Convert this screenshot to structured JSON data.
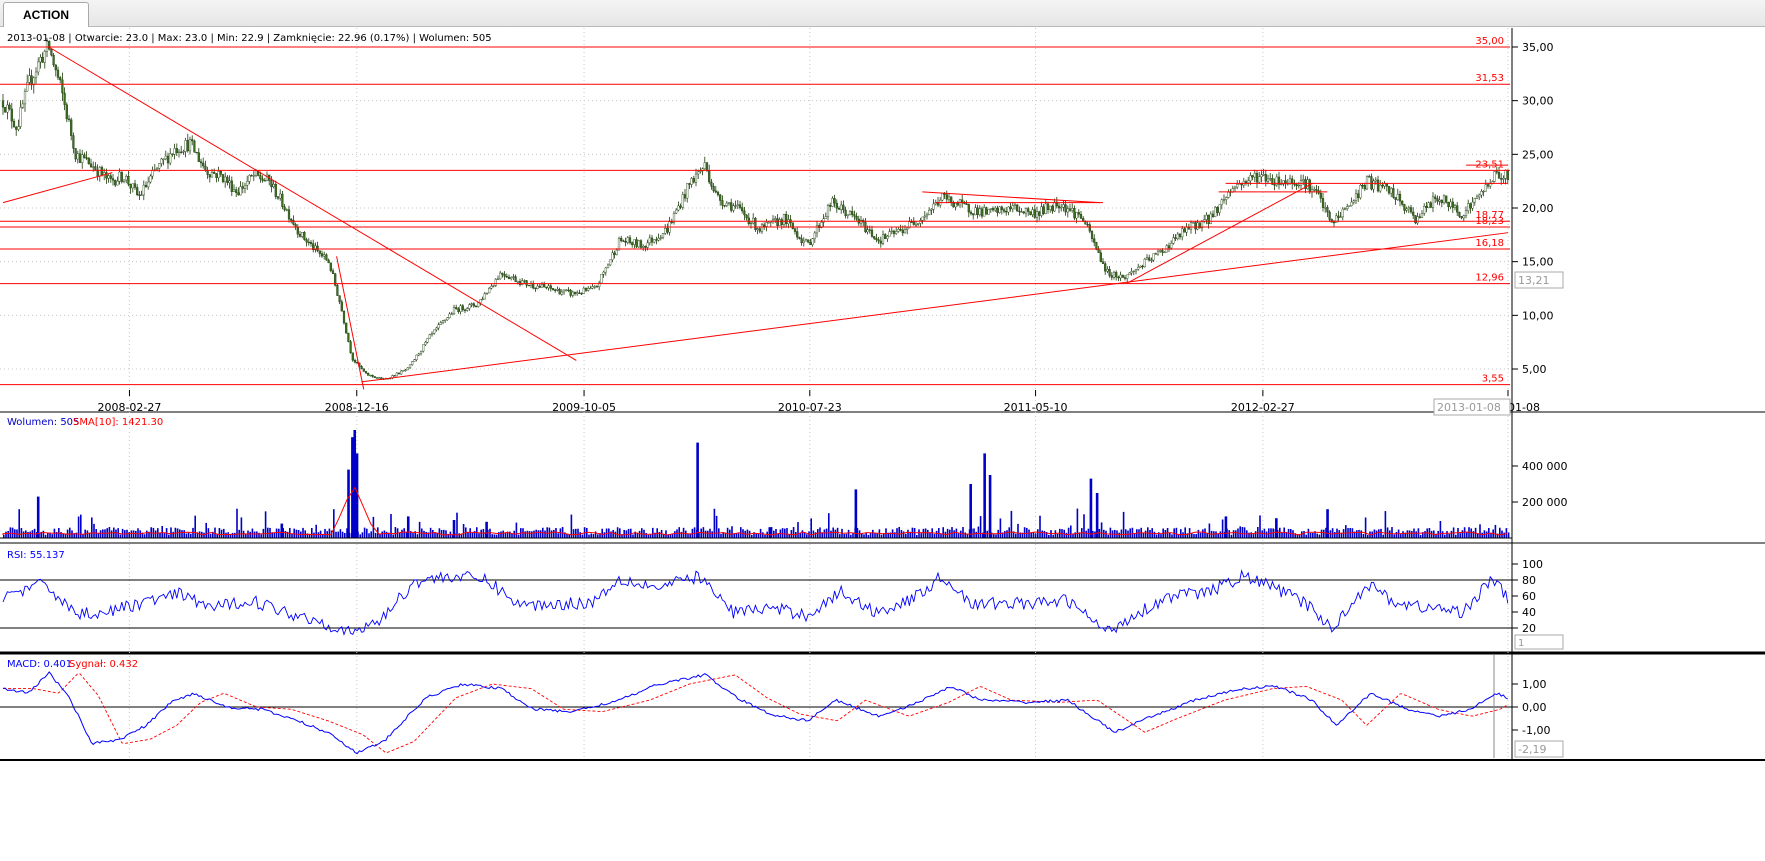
{
  "tab": {
    "label": "ACTION"
  },
  "price_panel": {
    "info": "2013-01-08 | Otwarcie: 23.0 | Max: 23.0 | Min: 22.9 | Zamknięcie: 22.96 (0.17%) | Wolumen: 505",
    "last_price_badge": "13,21",
    "last_date_badge": "2013-01-08"
  },
  "colors": {
    "up": "#3c6e20",
    "support": "#ff0000",
    "volume": "#0000c8",
    "rsi": "#0000ff",
    "macd": "#0000ff",
    "signal": "#ff0000"
  },
  "chart_data": [
    {
      "type": "candlestick",
      "x_ticks": [
        "2008-02-27",
        "2008-12-16",
        "2009-10-05",
        "2010-07-23",
        "2011-05-10",
        "2012-02-27",
        "2013-01-08"
      ],
      "y_ticks": [
        "35,00",
        "30,00",
        "25,00",
        "20,00",
        "15,00",
        "10,00",
        "5,00"
      ],
      "ylim": [
        2.5,
        36.5
      ],
      "x_range": [
        "2007-09-17",
        "2013-01-08"
      ],
      "close_path": [
        [
          "2007-09-17",
          30.0
        ],
        [
          "2007-10-05",
          27.5
        ],
        [
          "2007-10-20",
          31.5
        ],
        [
          "2007-11-05",
          34.0
        ],
        [
          "2007-11-15",
          35.0
        ],
        [
          "2007-12-01",
          31.0
        ],
        [
          "2007-12-20",
          25.0
        ],
        [
          "2008-01-10",
          24.0
        ],
        [
          "2008-02-01",
          22.5
        ],
        [
          "2008-02-20",
          23.0
        ],
        [
          "2008-03-10",
          21.0
        ],
        [
          "2008-04-01",
          23.5
        ],
        [
          "2008-04-25",
          25.5
        ],
        [
          "2008-05-15",
          26.0
        ],
        [
          "2008-06-05",
          23.5
        ],
        [
          "2008-06-25",
          23.0
        ],
        [
          "2008-07-15",
          21.5
        ],
        [
          "2008-08-05",
          23.0
        ],
        [
          "2008-08-25",
          22.5
        ],
        [
          "2008-09-15",
          20.0
        ],
        [
          "2008-10-05",
          17.5
        ],
        [
          "2008-10-25",
          16.0
        ],
        [
          "2008-11-10",
          15.0
        ],
        [
          "2008-11-25",
          11.0
        ],
        [
          "2008-12-10",
          6.0
        ],
        [
          "2008-12-28",
          4.5
        ],
        [
          "2009-01-20",
          4.0
        ],
        [
          "2009-02-20",
          5.0
        ],
        [
          "2009-03-20",
          8.0
        ],
        [
          "2009-04-20",
          10.5
        ],
        [
          "2009-05-20",
          11.0
        ],
        [
          "2009-06-20",
          14.0
        ],
        [
          "2009-07-20",
          13.0
        ],
        [
          "2009-08-20",
          12.5
        ],
        [
          "2009-09-20",
          12.0
        ],
        [
          "2009-10-20",
          12.5
        ],
        [
          "2009-11-20",
          17.0
        ],
        [
          "2009-12-20",
          16.5
        ],
        [
          "2010-01-20",
          18.0
        ],
        [
          "2010-02-20",
          22.5
        ],
        [
          "2010-03-10",
          24.0
        ],
        [
          "2010-03-25",
          21.0
        ],
        [
          "2010-04-20",
          20.0
        ],
        [
          "2010-05-20",
          18.0
        ],
        [
          "2010-06-20",
          19.0
        ],
        [
          "2010-07-20",
          16.5
        ],
        [
          "2010-08-20",
          20.5
        ],
        [
          "2010-09-20",
          19.0
        ],
        [
          "2010-10-20",
          17.0
        ],
        [
          "2010-11-20",
          18.0
        ],
        [
          "2010-12-20",
          19.5
        ],
        [
          "2011-01-10",
          21.0
        ],
        [
          "2011-02-10",
          20.0
        ],
        [
          "2011-03-10",
          19.5
        ],
        [
          "2011-04-10",
          20.0
        ],
        [
          "2011-05-10",
          19.5
        ],
        [
          "2011-06-10",
          20.5
        ],
        [
          "2011-07-10",
          19.0
        ],
        [
          "2011-08-10",
          14.0
        ],
        [
          "2011-09-01",
          13.5
        ],
        [
          "2011-09-20",
          14.5
        ],
        [
          "2011-10-20",
          16.0
        ],
        [
          "2011-11-20",
          18.0
        ],
        [
          "2011-12-20",
          19.0
        ],
        [
          "2012-01-20",
          22.0
        ],
        [
          "2012-02-20",
          23.0
        ],
        [
          "2012-03-20",
          22.5
        ],
        [
          "2012-04-20",
          22.5
        ],
        [
          "2012-05-10",
          21.0
        ],
        [
          "2012-05-25",
          18.5
        ],
        [
          "2012-06-20",
          20.5
        ],
        [
          "2012-07-10",
          22.5
        ],
        [
          "2012-08-10",
          21.5
        ],
        [
          "2012-09-10",
          19.0
        ],
        [
          "2012-10-10",
          21.0
        ],
        [
          "2012-11-10",
          19.5
        ],
        [
          "2012-12-01",
          21.0
        ],
        [
          "2012-12-20",
          23.0
        ],
        [
          "2013-01-08",
          22.96
        ]
      ],
      "level_labels": [
        "35,00",
        "31,53",
        "23,51",
        "18,77",
        "18,23",
        "16,18",
        "12,96",
        "3,55"
      ],
      "levels": [
        35.0,
        31.53,
        23.51,
        18.77,
        18.23,
        16.18,
        12.96,
        3.55
      ]
    },
    {
      "type": "bar",
      "title": "Wolumen: 505",
      "sma_label": "SMA[10]: 1421.30",
      "y_ticks": [
        "400 000",
        "200 000"
      ],
      "ylim": [
        0,
        600000
      ],
      "spikes": [
        [
          "2007-11-01",
          230000
        ],
        [
          "2008-12-05",
          380000
        ],
        [
          "2008-12-10",
          560000
        ],
        [
          "2008-12-13",
          600000
        ],
        [
          "2008-12-16",
          470000
        ],
        [
          "2009-02-20",
          120000
        ],
        [
          "2009-04-20",
          100000
        ],
        [
          "2010-02-28",
          530000
        ],
        [
          "2010-09-20",
          270000
        ],
        [
          "2011-02-15",
          300000
        ],
        [
          "2011-03-05",
          470000
        ],
        [
          "2011-03-12",
          350000
        ],
        [
          "2011-07-20",
          330000
        ],
        [
          "2011-07-28",
          250000
        ],
        [
          "2012-05-20",
          160000
        ],
        [
          "2012-01-10",
          120000
        ],
        [
          "2012-03-15",
          110000
        ],
        [
          "2008-09-10",
          80000
        ],
        [
          "2009-06-01",
          90000
        ],
        [
          "2010-06-01",
          60000
        ]
      ]
    },
    {
      "type": "line",
      "title": "RSI: 55.137",
      "y_ticks": [
        "100",
        "80",
        "60",
        "40",
        "20"
      ],
      "ylim": [
        10,
        100
      ],
      "badge": "1",
      "path": [
        [
          "2007-09-17",
          60
        ],
        [
          "2007-11-10",
          75
        ],
        [
          "2007-12-20",
          38
        ],
        [
          "2008-02-01",
          40
        ],
        [
          "2008-03-15",
          52
        ],
        [
          "2008-05-01",
          62
        ],
        [
          "2008-06-15",
          45
        ],
        [
          "2008-08-01",
          55
        ],
        [
          "2008-09-15",
          40
        ],
        [
          "2008-11-01",
          28
        ],
        [
          "2008-12-10",
          12
        ],
        [
          "2009-01-15",
          30
        ],
        [
          "2009-03-01",
          78
        ],
        [
          "2009-04-15",
          85
        ],
        [
          "2009-06-01",
          80
        ],
        [
          "2009-07-15",
          48
        ],
        [
          "2009-09-01",
          50
        ],
        [
          "2009-10-15",
          52
        ],
        [
          "2009-11-20",
          82
        ],
        [
          "2010-01-10",
          70
        ],
        [
          "2010-03-01",
          85
        ],
        [
          "2010-04-15",
          40
        ],
        [
          "2010-06-01",
          45
        ],
        [
          "2010-07-20",
          36
        ],
        [
          "2010-09-01",
          65
        ],
        [
          "2010-10-15",
          40
        ],
        [
          "2010-12-01",
          55
        ],
        [
          "2011-01-10",
          85
        ],
        [
          "2011-02-20",
          48
        ],
        [
          "2011-04-01",
          52
        ],
        [
          "2011-05-10",
          50
        ],
        [
          "2011-06-20",
          55
        ],
        [
          "2011-08-10",
          15
        ],
        [
          "2011-09-20",
          40
        ],
        [
          "2011-11-01",
          60
        ],
        [
          "2011-12-20",
          65
        ],
        [
          "2012-02-01",
          85
        ],
        [
          "2012-03-15",
          70
        ],
        [
          "2012-05-01",
          45
        ],
        [
          "2012-05-25",
          18
        ],
        [
          "2012-07-10",
          75
        ],
        [
          "2012-08-20",
          50
        ],
        [
          "2012-10-01",
          45
        ],
        [
          "2012-11-10",
          40
        ],
        [
          "2012-12-20",
          82
        ],
        [
          "2013-01-08",
          55
        ]
      ]
    },
    {
      "type": "line",
      "title": "MACD: 0.401",
      "signal_label": "Sygnał: 0.432",
      "y_ticks": [
        "1,00",
        "0,00",
        "-1,00"
      ],
      "ylim": [
        -2.2,
        1.6
      ],
      "badge": "-2,19",
      "path": [
        [
          "2007-09-17",
          0.8
        ],
        [
          "2007-10-20",
          0.6
        ],
        [
          "2007-11-15",
          1.5
        ],
        [
          "2007-12-10",
          0.5
        ],
        [
          "2008-01-10",
          -1.6
        ],
        [
          "2008-02-15",
          -1.4
        ],
        [
          "2008-03-20",
          -0.8
        ],
        [
          "2008-04-20",
          0.2
        ],
        [
          "2008-05-20",
          0.6
        ],
        [
          "2008-07-01",
          0.0
        ],
        [
          "2008-08-15",
          -0.1
        ],
        [
          "2008-10-01",
          -0.6
        ],
        [
          "2008-11-15",
          -1.2
        ],
        [
          "2008-12-15",
          -2.0
        ],
        [
          "2009-01-20",
          -1.5
        ],
        [
          "2009-03-15",
          0.4
        ],
        [
          "2009-05-01",
          1.0
        ],
        [
          "2009-06-20",
          0.8
        ],
        [
          "2009-08-01",
          -0.1
        ],
        [
          "2009-09-20",
          -0.2
        ],
        [
          "2009-11-20",
          0.3
        ],
        [
          "2010-01-10",
          1.0
        ],
        [
          "2010-03-10",
          1.4
        ],
        [
          "2010-04-20",
          0.4
        ],
        [
          "2010-06-01",
          -0.3
        ],
        [
          "2010-07-20",
          -0.6
        ],
        [
          "2010-08-25",
          0.3
        ],
        [
          "2010-10-20",
          -0.4
        ],
        [
          "2010-12-10",
          0.2
        ],
        [
          "2011-01-20",
          0.9
        ],
        [
          "2011-03-01",
          0.3
        ],
        [
          "2011-05-01",
          0.2
        ],
        [
          "2011-06-20",
          0.3
        ],
        [
          "2011-08-20",
          -1.1
        ],
        [
          "2011-10-01",
          -0.5
        ],
        [
          "2011-12-01",
          0.3
        ],
        [
          "2012-02-01",
          0.8
        ],
        [
          "2012-03-15",
          0.9
        ],
        [
          "2012-04-30",
          0.3
        ],
        [
          "2012-06-01",
          -0.8
        ],
        [
          "2012-07-15",
          0.6
        ],
        [
          "2012-09-01",
          -0.1
        ],
        [
          "2012-10-15",
          -0.4
        ],
        [
          "2012-11-20",
          -0.1
        ],
        [
          "2012-12-25",
          0.6
        ],
        [
          "2013-01-08",
          0.401
        ]
      ]
    }
  ]
}
